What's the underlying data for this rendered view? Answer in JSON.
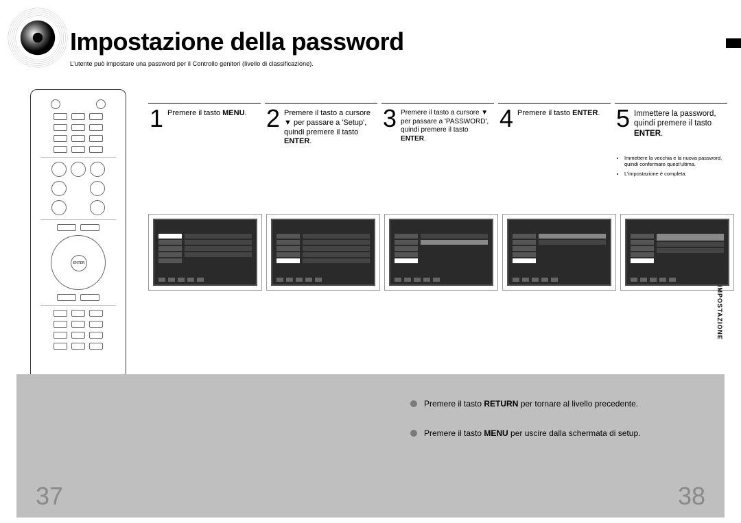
{
  "header": {
    "title": "Impostazione della password",
    "subtitle": "L'utente può impostare una password per il Controllo genitori (livello di classificazione)."
  },
  "side_label": "IMPOSTAZIONE",
  "steps": [
    {
      "num": "1",
      "text_pre": "Premere il tasto ",
      "bold": "MENU",
      "text_post": "."
    },
    {
      "num": "2",
      "text_pre": "Premere il tasto a cursore ▼ per passare a 'Setup', quindi premere il tasto ",
      "bold": "ENTER",
      "text_post": "."
    },
    {
      "num": "3",
      "text_pre": "Premere il tasto a cursore ▼ per passare a 'PASSWORD', quindi premere il tasto ",
      "bold": "ENTER",
      "text_post": "."
    },
    {
      "num": "4",
      "text_pre": "Premere il tasto ",
      "bold": "ENTER",
      "text_post": "."
    },
    {
      "num": "5",
      "text_pre": "Immettere la password, quindi premere il tasto ",
      "bold": "ENTER",
      "text_post": "."
    }
  ],
  "step5_bullets": [
    "Immettere la vecchia e la nuova password, quindi confermare quest'ultima.",
    "L'impostazione è completa."
  ],
  "footer": {
    "note1_pre": "Premere il tasto ",
    "note1_bold": "RETURN",
    "note1_post": " per tornare al livello precedente.",
    "note2_pre": "Premere il tasto ",
    "note2_bold": "MENU",
    "note2_post": " per uscire dalla schermata di setup."
  },
  "pages": {
    "left": "37",
    "right": "38"
  },
  "remote": {
    "enter_label": "ENTER"
  }
}
